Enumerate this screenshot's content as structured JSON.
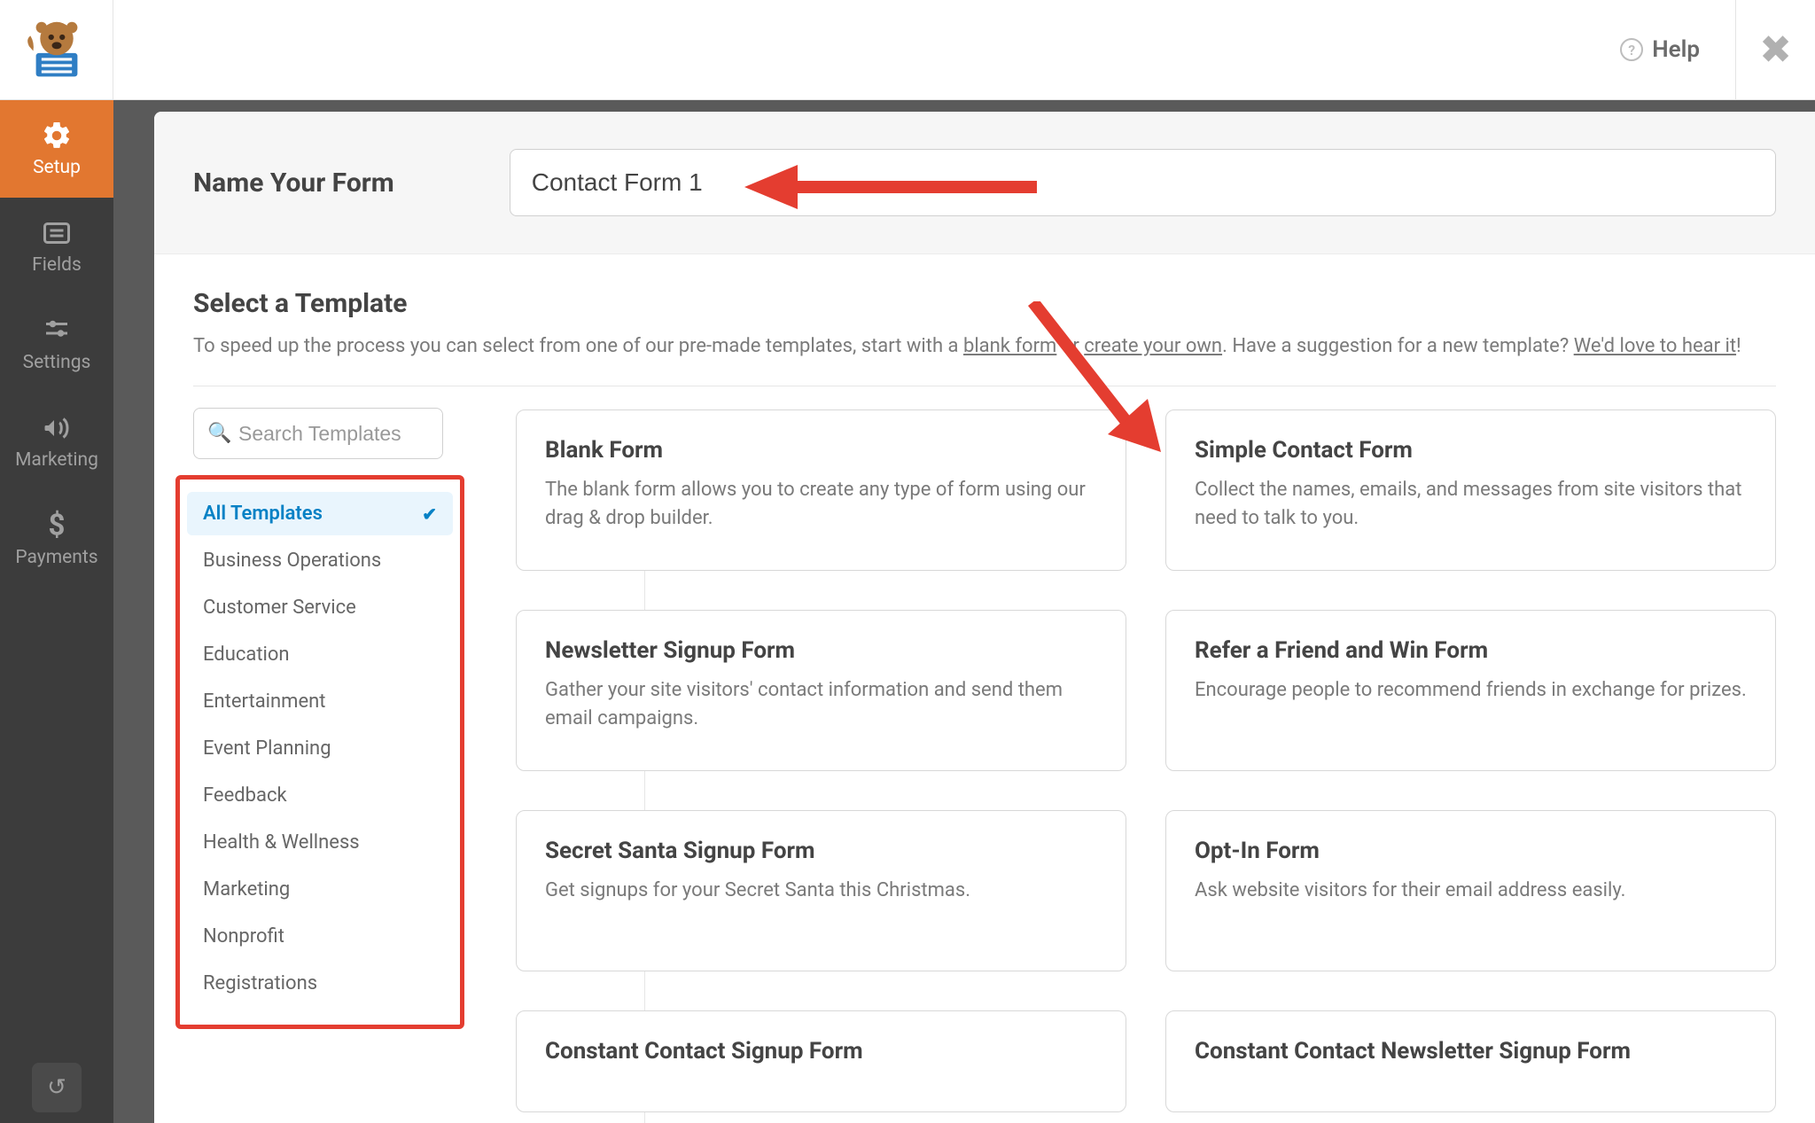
{
  "topbar": {
    "help_label": "Help"
  },
  "sidebar": {
    "items": [
      {
        "label": "Setup"
      },
      {
        "label": "Fields"
      },
      {
        "label": "Settings"
      },
      {
        "label": "Marketing"
      },
      {
        "label": "Payments"
      }
    ]
  },
  "name_section": {
    "label": "Name Your Form",
    "value": "Contact Form 1"
  },
  "template_section": {
    "title": "Select a Template",
    "desc_pre": "To speed up the process you can select from one of our pre-made templates, start with a ",
    "link_blank": "blank form",
    "desc_mid1": " or ",
    "link_create": "create your own",
    "desc_mid2": ". Have a suggestion for a new template? ",
    "link_suggest": "We'd love to hear it",
    "desc_end": "!"
  },
  "search": {
    "placeholder": "Search Templates"
  },
  "categories": [
    "All Templates",
    "Business Operations",
    "Customer Service",
    "Education",
    "Entertainment",
    "Event Planning",
    "Feedback",
    "Health & Wellness",
    "Marketing",
    "Nonprofit",
    "Registrations"
  ],
  "templates": [
    {
      "title": "Blank Form",
      "desc": "The blank form allows you to create any type of form using our drag & drop builder."
    },
    {
      "title": "Simple Contact Form",
      "desc": "Collect the names, emails, and messages from site visitors that need to talk to you."
    },
    {
      "title": "Newsletter Signup Form",
      "desc": "Gather your site visitors' contact information and send them email campaigns."
    },
    {
      "title": "Refer a Friend and Win Form",
      "desc": "Encourage people to recommend friends in exchange for prizes."
    },
    {
      "title": "Secret Santa Signup Form",
      "desc": "Get signups for your Secret Santa this Christmas."
    },
    {
      "title": "Opt-In Form",
      "desc": "Ask website visitors for their email address easily."
    },
    {
      "title": "Constant Contact Signup Form",
      "desc": ""
    },
    {
      "title": "Constant Contact Newsletter Signup Form",
      "desc": ""
    }
  ]
}
